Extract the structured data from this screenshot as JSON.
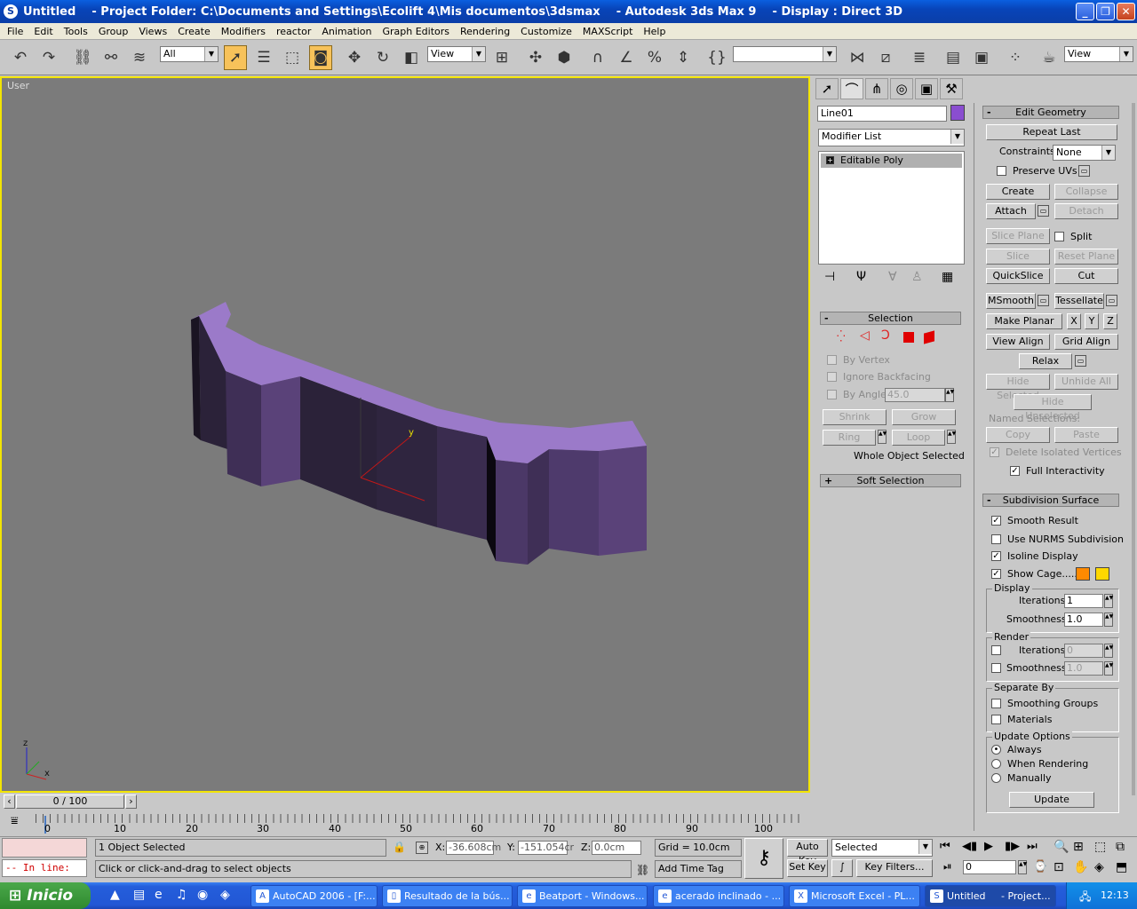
{
  "window": {
    "title": "Untitled    - Project Folder: C:\\Documents and Settings\\Ecolift 4\\Mis documentos\\3dsmax    - Autodesk 3ds Max 9    - Display : Direct 3D"
  },
  "menu": [
    "File",
    "Edit",
    "Tools",
    "Group",
    "Views",
    "Create",
    "Modifiers",
    "reactor",
    "Animation",
    "Graph Editors",
    "Rendering",
    "Customize",
    "MAXScript",
    "Help"
  ],
  "toolbar": {
    "selection_filter": "All",
    "ref_coord": "View",
    "named_selection": "",
    "view_dropdown": "View"
  },
  "viewport": {
    "label": "User",
    "axis": {
      "z": "z",
      "x": "x",
      "y": "y"
    },
    "colors": {
      "top": "#9b7ac9",
      "side": "#5a4279",
      "dark": "#2b2239",
      "bg": "#7b7b7b"
    }
  },
  "command_panel": {
    "object_name": "Line01",
    "object_color": "#8a4ed0",
    "modifier_list": "Modifier List",
    "stack": [
      "Editable Poly"
    ],
    "selection": {
      "title": "Selection",
      "by_vertex": "By Vertex",
      "ignore_backfacing": "Ignore Backfacing",
      "by_angle": "By Angle:",
      "angle_value": "45.0",
      "shrink": "Shrink",
      "grow": "Grow",
      "ring": "Ring",
      "loop": "Loop",
      "status": "Whole Object Selected"
    },
    "soft_selection": "Soft Selection",
    "edit_geometry": {
      "title": "Edit Geometry",
      "repeat_last": "Repeat Last",
      "constraints_label": "Constraints:",
      "constraints_value": "None",
      "preserve_uvs": "Preserve UVs",
      "create": "Create",
      "collapse": "Collapse",
      "attach": "Attach",
      "detach": "Detach",
      "slice_plane": "Slice Plane",
      "split": "Split",
      "slice": "Slice",
      "reset_plane": "Reset Plane",
      "quickslice": "QuickSlice",
      "cut": "Cut",
      "msmooth": "MSmooth",
      "tessellate": "Tessellate",
      "make_planar": "Make Planar",
      "x": "X",
      "y": "Y",
      "z": "Z",
      "view_align": "View Align",
      "grid_align": "Grid Align",
      "relax": "Relax",
      "hide_selected": "Hide Selected",
      "unhide_all": "Unhide All",
      "hide_unselected": "Hide Unselected",
      "named_selections": "Named Selections:",
      "copy": "Copy",
      "paste": "Paste",
      "delete_isolated": "Delete Isolated Vertices",
      "full_interactivity": "Full Interactivity"
    },
    "subdivision": {
      "title": "Subdivision Surface",
      "smooth_result": "Smooth Result",
      "use_nurms": "Use NURMS Subdivision",
      "isoline": "Isoline Display",
      "show_cage": "Show Cage......",
      "cage_color1": "#ff8a00",
      "cage_color2": "#ffd800",
      "display": "Display",
      "iterations_label": "Iterations:",
      "display_iterations": "1",
      "smoothness_label": "Smoothness:",
      "display_smoothness": "1.0",
      "render": "Render",
      "render_iterations": "0",
      "render_smoothness": "1.0",
      "separate_by": "Separate By",
      "smoothing_groups": "Smoothing Groups",
      "materials": "Materials",
      "update_options": "Update Options",
      "always": "Always",
      "when_rendering": "When Rendering",
      "manually": "Manually",
      "update": "Update"
    }
  },
  "timeline": {
    "slider": "0 / 100",
    "ticks": [
      "0",
      "10",
      "20",
      "30",
      "40",
      "50",
      "60",
      "70",
      "80",
      "90",
      "100"
    ]
  },
  "status": {
    "maxscript_label": "-- In line:",
    "selected_count": "1 Object Selected",
    "prompt": "Click or click-and-drag to select objects",
    "x_label": "X:",
    "x_value": "-36.608cm",
    "y_label": "Y:",
    "y_value": "-151.054cr",
    "z_label": "Z:",
    "z_value": "0.0cm",
    "grid": "Grid = 10.0cm",
    "add_time_tag": "Add Time Tag",
    "auto_key": "Auto Key",
    "set_key": "Set Key",
    "selected": "Selected",
    "key_filters": "Key Filters...",
    "frame": "0"
  },
  "taskbar": {
    "start": "Inicio",
    "tasks": [
      "AutoCAD 2006 - [F:...",
      "Resultado de la bús...",
      "Beatport - Windows...",
      "acerado inclinado - ...",
      "Microsoft Excel - PL...",
      "Untitled     - Project..."
    ],
    "clock": "12:13"
  }
}
